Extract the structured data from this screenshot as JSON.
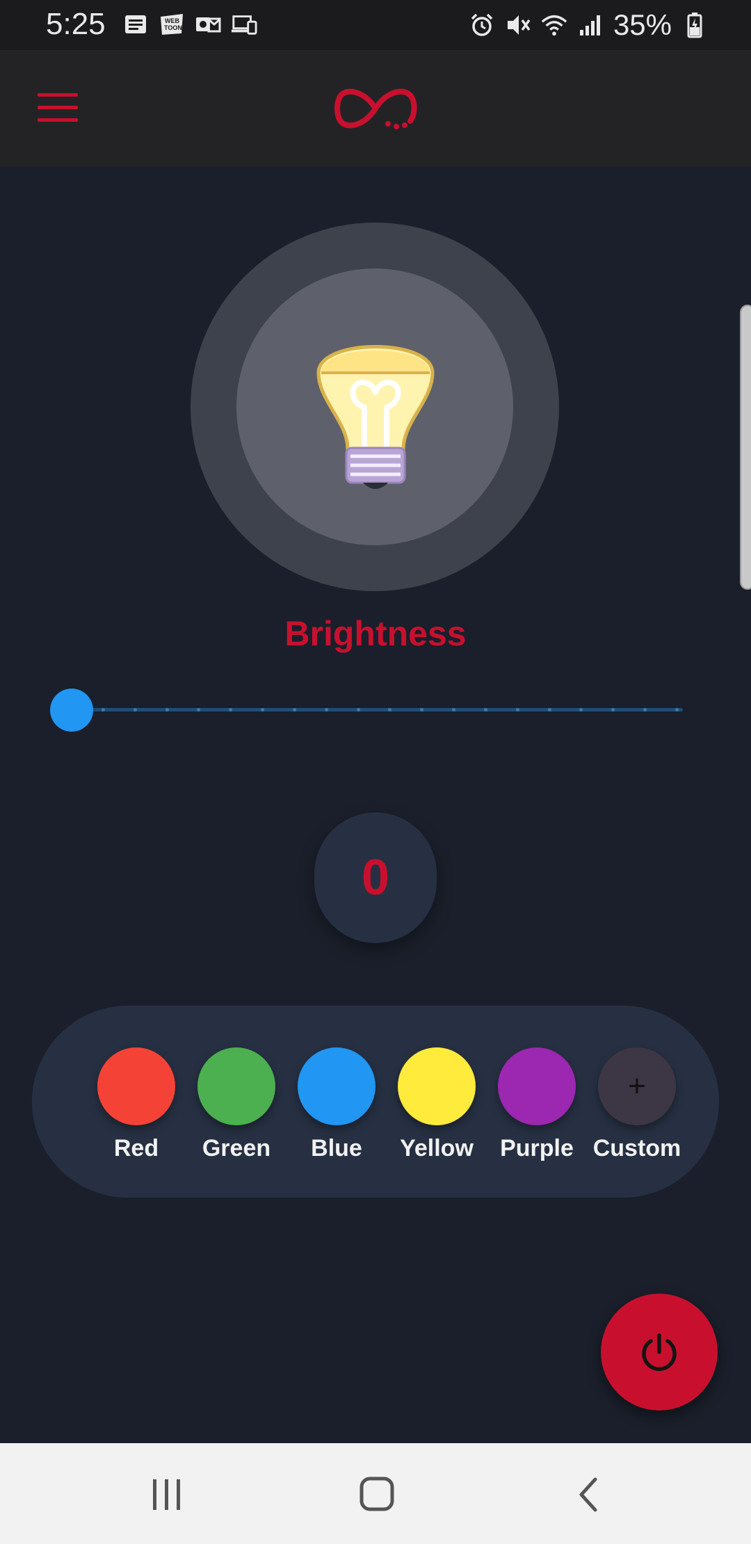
{
  "status_bar": {
    "time": "5:25",
    "battery_percent": "35%",
    "left_icons": [
      "news-icon",
      "webtoon-icon",
      "outlook-icon",
      "devices-icon"
    ],
    "right_icons": [
      "alarm-icon",
      "mute-icon",
      "wifi-icon",
      "signal-icon",
      "battery-icon"
    ]
  },
  "app_bar": {
    "menu_icon": "hamburger-menu-icon",
    "logo_icon": "infinity-logo-icon",
    "accent_color": "#c8102e"
  },
  "main": {
    "bulb_icon": "light-bulb-icon",
    "brightness_label": "Brightness",
    "brightness_value": "0",
    "slider_level": 0
  },
  "colors": [
    {
      "label": "Red",
      "color": "#f44336"
    },
    {
      "label": "Green",
      "color": "#4caf50"
    },
    {
      "label": "Blue",
      "color": "#2196f3"
    },
    {
      "label": "Yellow",
      "color": "#ffeb3b"
    },
    {
      "label": "Purple",
      "color": "#9c27b0"
    },
    {
      "label": "Custom",
      "color": "#3d3645",
      "icon": "plus-icon"
    }
  ],
  "fab": {
    "icon": "power-icon",
    "color": "#c8102e"
  },
  "nav_bar": {
    "icons": [
      "recent-apps-icon",
      "home-icon",
      "back-icon"
    ]
  }
}
